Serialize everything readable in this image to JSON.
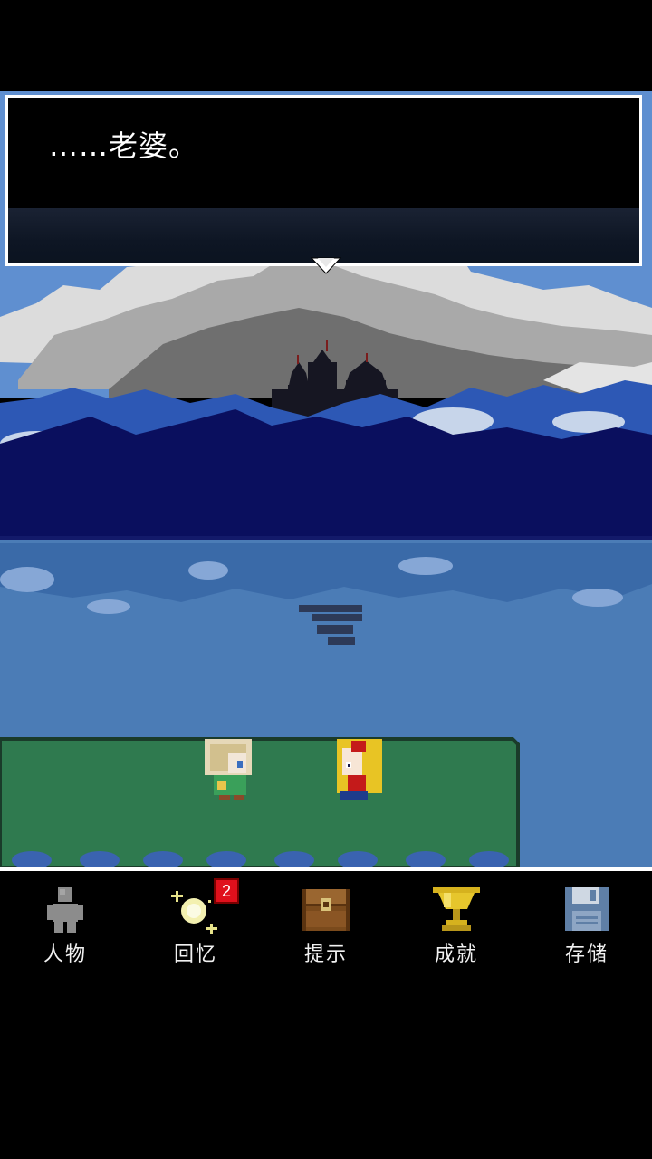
{
  "dialog": {
    "text": "……老婆。"
  },
  "menu": {
    "items": [
      {
        "label": "人物",
        "icon": "person-icon"
      },
      {
        "label": "回忆",
        "icon": "sparkle-memory-icon",
        "badge": "2"
      },
      {
        "label": "提示",
        "icon": "treasure-chest-icon"
      },
      {
        "label": "成就",
        "icon": "trophy-icon"
      },
      {
        "label": "存储",
        "icon": "floppy-disk-icon"
      }
    ]
  },
  "colors": {
    "sky": "#5f8fd0",
    "mountain_far": "#2a50a8",
    "mountain_near": "#0a1060",
    "sea": "#4a7db8",
    "grass": "#2e7a4e",
    "badge": "#e0101c"
  }
}
